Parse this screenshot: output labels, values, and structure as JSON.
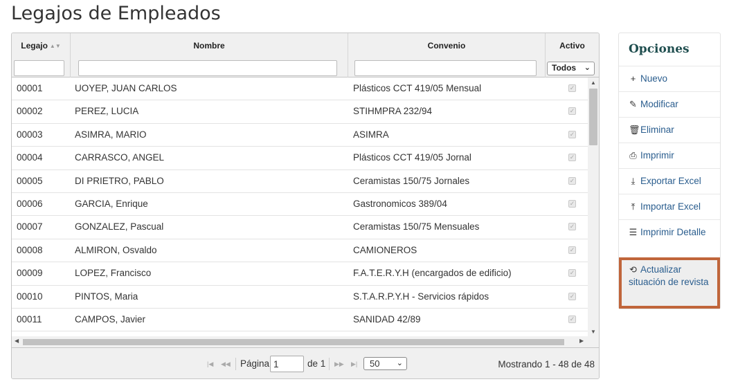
{
  "page": {
    "title": "Legajos de Empleados"
  },
  "grid": {
    "columns": {
      "legajo": "Legajo",
      "nombre": "Nombre",
      "convenio": "Convenio",
      "activo": "Activo"
    },
    "filters": {
      "activo_selected": "Todos"
    },
    "rows": [
      {
        "legajo": "00001",
        "nombre": "UOYEP, JUAN CARLOS",
        "convenio": "Plásticos CCT 419/05 Mensual"
      },
      {
        "legajo": "00002",
        "nombre": "PEREZ, LUCIA",
        "convenio": "STIHMPRA 232/94"
      },
      {
        "legajo": "00003",
        "nombre": "ASIMRA, MARIO",
        "convenio": "ASIMRA"
      },
      {
        "legajo": "00004",
        "nombre": "CARRASCO, ANGEL",
        "convenio": "Plásticos CCT 419/05 Jornal"
      },
      {
        "legajo": "00005",
        "nombre": "DI PRIETRO, PABLO",
        "convenio": "Ceramistas 150/75 Jornales"
      },
      {
        "legajo": "00006",
        "nombre": "GARCIA, Enrique",
        "convenio": "Gastronomicos 389/04"
      },
      {
        "legajo": "00007",
        "nombre": "GONZALEZ, Pascual",
        "convenio": "Ceramistas 150/75 Mensuales"
      },
      {
        "legajo": "00008",
        "nombre": "ALMIRON, Osvaldo",
        "convenio": "CAMIONEROS"
      },
      {
        "legajo": "00009",
        "nombre": "LOPEZ, Francisco",
        "convenio": "F.A.T.E.R.Y.H (encargados de edificio)"
      },
      {
        "legajo": "00010",
        "nombre": "PINTOS, Maria",
        "convenio": "S.T.A.R.P.Y.H - Servicios rápidos"
      },
      {
        "legajo": "00011",
        "nombre": "CAMPOS, Javier",
        "convenio": "SANIDAD 42/89"
      }
    ],
    "active_checkbox_symbol": "✓"
  },
  "pager": {
    "page_label": "Página",
    "page_value": "1",
    "of_label": "de 1",
    "rows_per_page": "50",
    "status": "Mostrando 1 - 48 de 48"
  },
  "options": {
    "title": "Opciones",
    "items": [
      {
        "icon": "plus-icon",
        "glyph": "+",
        "label": "Nuevo"
      },
      {
        "icon": "pencil-icon",
        "glyph": "✎",
        "label": "Modificar"
      },
      {
        "icon": "trash-icon",
        "glyph": "🗑",
        "label": "Eliminar"
      },
      {
        "icon": "print-icon",
        "glyph": "⎙",
        "label": "Imprimir"
      },
      {
        "icon": "download-icon",
        "glyph": "⤓",
        "label": "Exportar Excel"
      },
      {
        "icon": "upload-icon",
        "glyph": "⤒",
        "label": "Importar Excel"
      },
      {
        "icon": "list-icon",
        "glyph": "☰",
        "label": "Imprimir Detalle"
      },
      {
        "icon": "refresh-icon",
        "glyph": "⟲",
        "label": "Actualizar situación de revista"
      }
    ],
    "highlight_color": "#c0653a"
  }
}
